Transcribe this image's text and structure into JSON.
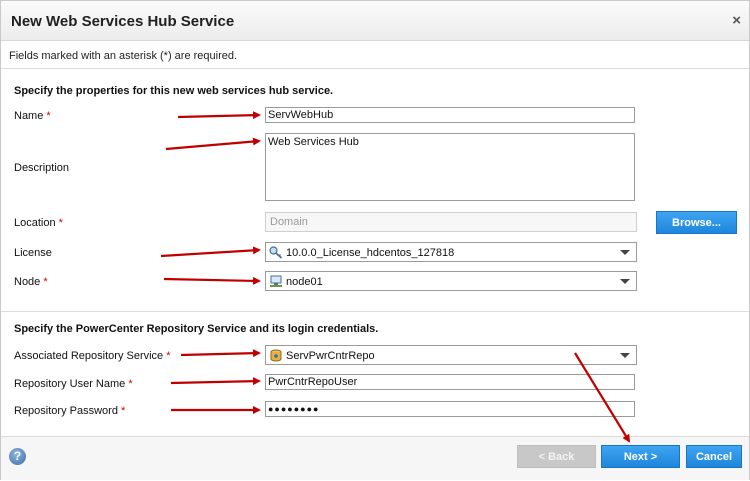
{
  "dialog": {
    "title": "New Web Services Hub Service",
    "close_glyph": "×",
    "required_note": "Fields marked with an asterisk (*) are required."
  },
  "section1": {
    "heading": "Specify the properties for this new web services hub service.",
    "name_label": "Name",
    "name_value": "ServWebHub",
    "description_label": "Description",
    "description_value": "Web Services Hub",
    "location_label": "Location",
    "location_placeholder": "Domain",
    "browse_label": "Browse...",
    "license_label": "License",
    "license_value": "10.0.0_License_hdcentos_127818",
    "node_label": "Node",
    "node_value": "node01"
  },
  "section2": {
    "heading": "Specify the PowerCenter Repository Service and its login credentials.",
    "repo_service_label": "Associated Repository Service",
    "repo_service_value": "ServPwrCntrRepo",
    "repo_user_label": "Repository User Name",
    "repo_user_value": "PwrCntrRepoUser",
    "repo_password_label": "Repository Password",
    "repo_password_value": "●●●●●●●●"
  },
  "footer": {
    "help_glyph": "?",
    "back_label": "< Back",
    "next_label": "Next >",
    "cancel_label": "Cancel"
  },
  "required_marker": "*",
  "icons": {
    "license": "license-key-icon",
    "node": "node-computer-icon",
    "repo": "repository-service-icon"
  },
  "colors": {
    "accent": "#1e86dc",
    "required": "#d10000",
    "annotation_arrow": "#c00000"
  }
}
